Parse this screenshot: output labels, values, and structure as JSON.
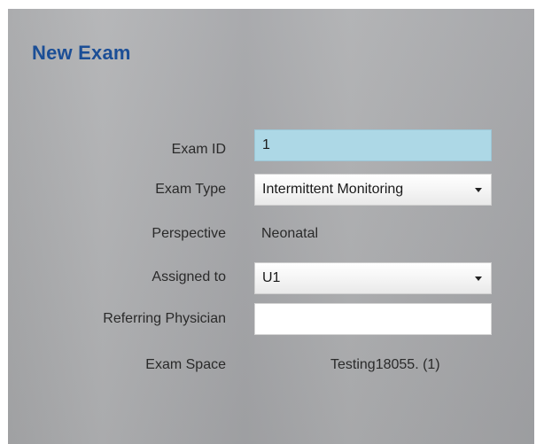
{
  "title": "New Exam",
  "fields": {
    "exam_id": {
      "label": "Exam ID",
      "value": "1"
    },
    "exam_type": {
      "label": "Exam Type",
      "value": "Intermittent Monitoring"
    },
    "perspective": {
      "label": "Perspective",
      "value": "Neonatal"
    },
    "assigned_to": {
      "label": "Assigned to",
      "value": "U1"
    },
    "referring_physician": {
      "label": "Referring Physician",
      "value": ""
    },
    "exam_space": {
      "label": "Exam Space",
      "value": "Testing18055. (1)"
    }
  },
  "colors": {
    "title": "#1b4e96",
    "exam_id_background": "#add8e6",
    "panel_background": "#aaabad"
  },
  "icons": {
    "dropdown": "chevron-down-icon"
  }
}
